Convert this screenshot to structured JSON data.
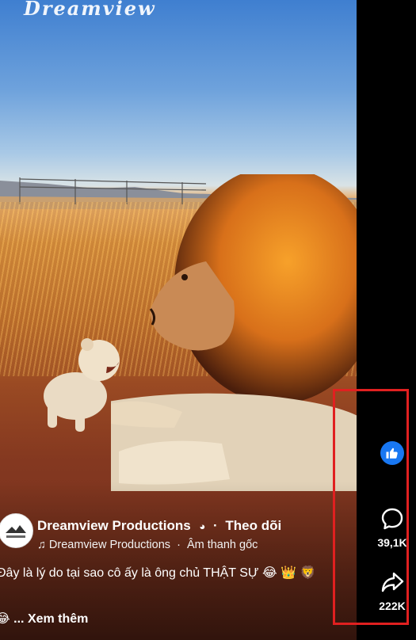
{
  "video": {
    "watermark": "Dreamview"
  },
  "actions": {
    "like": {
      "icon": "thumbs-up-icon"
    },
    "comment": {
      "icon": "comment-icon",
      "count": "39,1K"
    },
    "share": {
      "icon": "share-icon",
      "count": "222K"
    }
  },
  "channel": {
    "name": "Dreamview Productions",
    "follow_label": "Theo dõi",
    "audio_source": "Dreamview Productions",
    "audio_label": "Âm thanh gốc"
  },
  "caption": {
    "text": "Đây là lý do tại sao cô ấy là ông chủ THẬT SỰ",
    "more_label": "... Xem thêm"
  },
  "colors": {
    "like_blue": "#1877f2",
    "highlight_red": "#e02020"
  }
}
